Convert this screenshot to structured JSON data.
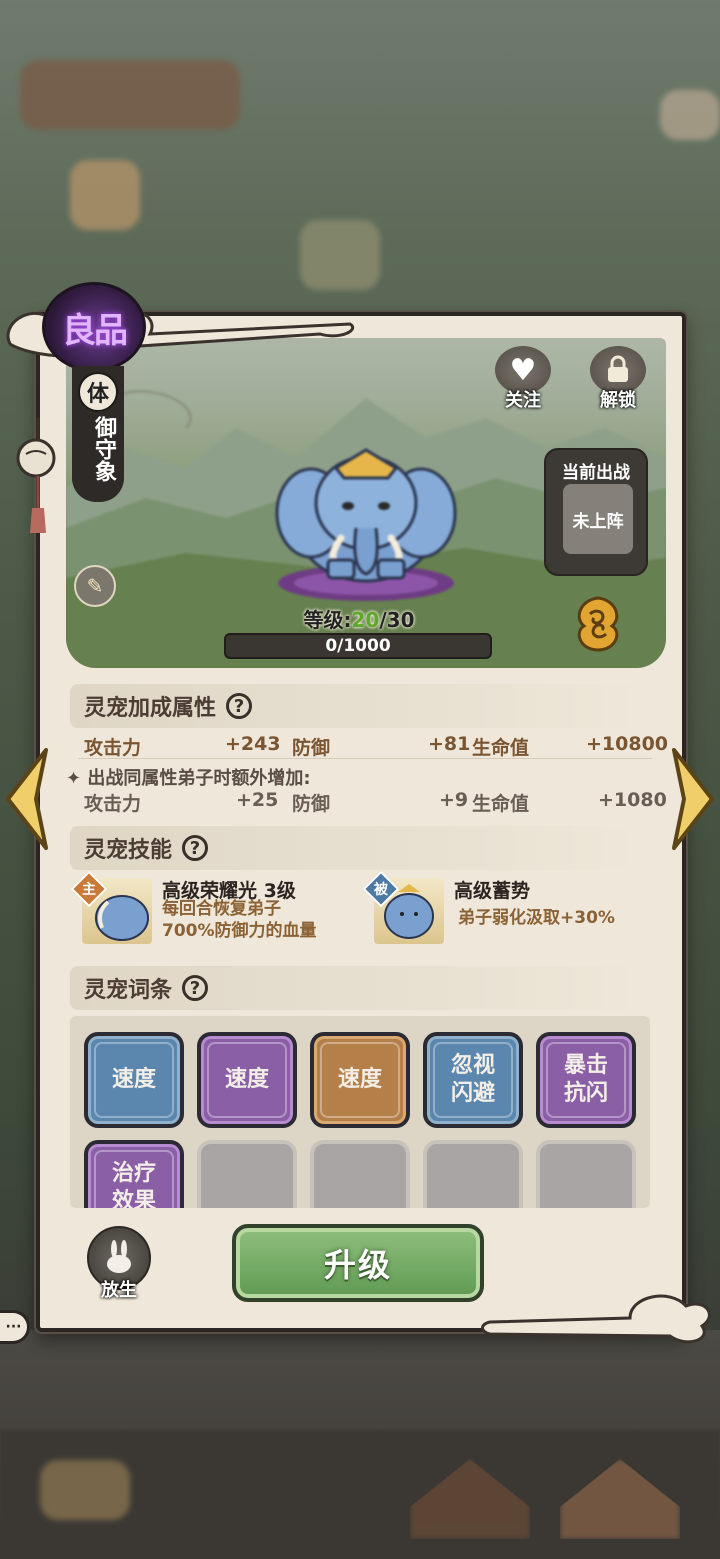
{
  "quality": "良品",
  "pet": {
    "element": "体",
    "name": "御守象"
  },
  "actions": {
    "follow_label": "关注",
    "unlock_label": "解锁"
  },
  "battle": {
    "title": "当前出战",
    "status": "未上阵"
  },
  "level": {
    "prefix": "等级:",
    "current": "20",
    "max": "/30"
  },
  "exp": {
    "text": "0/1000",
    "progress": 0
  },
  "attributes": {
    "title": "灵宠加成属性",
    "help": "?",
    "primary": [
      {
        "label": "攻击力",
        "value": "+243"
      },
      {
        "label": "防御",
        "value": "+81"
      },
      {
        "label": "生命值",
        "value": "+10800"
      }
    ],
    "note": "出战同属性弟子时额外增加:",
    "bonus": [
      {
        "label": "攻击力",
        "value": "+25"
      },
      {
        "label": "防御",
        "value": "+9"
      },
      {
        "label": "生命值",
        "value": "+1080"
      }
    ]
  },
  "skills": {
    "title": "灵宠技能",
    "help": "?",
    "list": [
      {
        "tag": "主",
        "name": "高级荣耀光 3级",
        "desc_line1": "每回合恢复弟子",
        "desc_line2": "700%防御力的血量"
      },
      {
        "tag": "被",
        "name": "高级蓄势",
        "desc_line1": "弟子弱化汲取+30%"
      }
    ]
  },
  "entries": {
    "title": "灵宠词条",
    "help": "?",
    "items": [
      {
        "label": "速度",
        "color": "blue"
      },
      {
        "label": "速度",
        "color": "purple"
      },
      {
        "label": "速度",
        "color": "orange"
      },
      {
        "label": "忽视闪避",
        "color": "blue"
      },
      {
        "label": "暴击抗闪",
        "color": "purple"
      },
      {
        "label": "治疗效果",
        "color": "purple"
      },
      {
        "label": "",
        "color": "empty"
      },
      {
        "label": "",
        "color": "empty"
      },
      {
        "label": "",
        "color": "empty"
      },
      {
        "label": "",
        "color": "empty"
      }
    ]
  },
  "buttons": {
    "release_label": "放生",
    "upgrade_label": "升级"
  },
  "colors": {
    "panel": "#efe8da",
    "level_current": "#5ea82d",
    "upgrade_green": "#6fa85f",
    "quality_purple": "#6c3d90"
  }
}
